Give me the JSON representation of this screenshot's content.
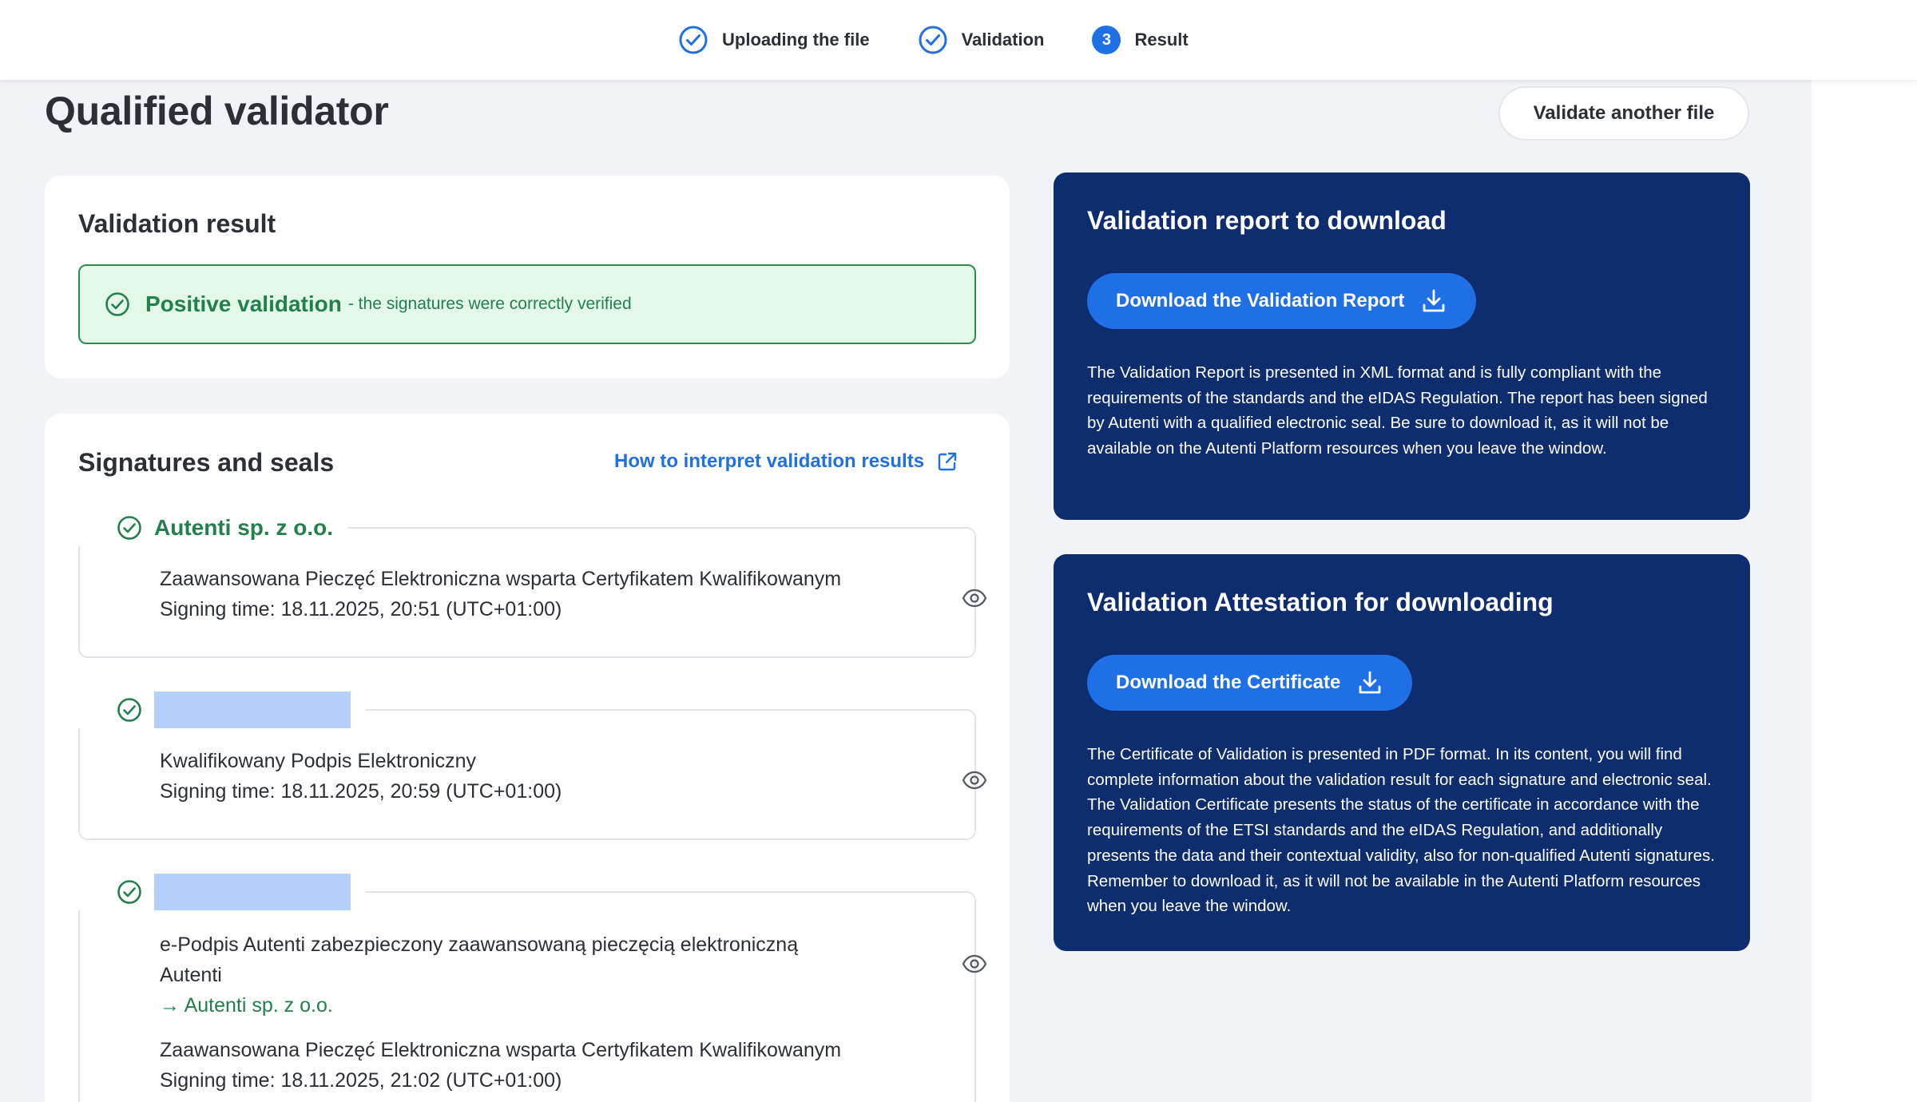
{
  "stepper": {
    "steps": [
      {
        "label": "Uploading the file",
        "state": "done"
      },
      {
        "label": "Validation",
        "state": "done"
      },
      {
        "label": "Result",
        "state": "current",
        "number": "3"
      }
    ]
  },
  "header": {
    "title": "Qualified validator",
    "validate_another_label": "Validate another file"
  },
  "validation_result": {
    "title": "Validation result",
    "status_strong": "Positive validation",
    "status_rest": " - the signatures were correctly verified"
  },
  "signatures": {
    "title": "Signatures and seals",
    "help_link": "How to interpret validation results",
    "items": [
      {
        "name": "Autenti sp. z o.o.",
        "type": "Zaawansowana Pieczęć Elektroniczna wsparta Certyfikatem Kwalifikowanym",
        "signing_time": "Signing time: 18.11.2025, 20:51 (UTC+01:00)"
      },
      {
        "name": "",
        "type": "Kwalifikowany Podpis Elektroniczny",
        "signing_time": "Signing time: 18.11.2025, 20:59 (UTC+01:00)"
      },
      {
        "name": "",
        "type_line1": "e-Podpis Autenti zabezpieczony zaawansowaną pieczęcią elektroniczną",
        "type_line2": "Autenti",
        "sealed_by": "Autenti sp. z o.o.",
        "type": "Zaawansowana Pieczęć Elektroniczna wsparta Certyfikatem Kwalifikowanym",
        "signing_time": "Signing time: 18.11.2025, 21:02 (UTC+01:00)"
      }
    ]
  },
  "report": {
    "title": "Validation report to download",
    "button_label": "Download the Validation Report",
    "description": "The Validation Report is presented in XML format and is fully compliant with the requirements of the standards and the eIDAS Regulation. The report has been signed by Autenti with a qualified electronic seal. Be sure to download it, as it will not be available on the Autenti Platform resources when you leave the window."
  },
  "attestation": {
    "title": "Validation Attestation for downloading",
    "button_label": "Download the Certificate",
    "description": "The Certificate of Validation is presented in PDF format. In its content, you will find complete information about the validation result for each signature and electronic seal. The Validation Certificate presents the status of the certificate in accordance with the requirements of the ETSI standards and the eIDAS Regulation, and additionally presents the data and their contextual validity, also for non-qualified Autenti signatures. Remember to download it, as it will not be available in the Autenti Platform resources when you leave the window."
  },
  "colors": {
    "accent_blue": "#1f6fe5",
    "dark_navy": "#0e2d6e",
    "success_green": "#23804a",
    "success_bg": "#e4f8ea",
    "redaction": "#b3d1fb"
  }
}
